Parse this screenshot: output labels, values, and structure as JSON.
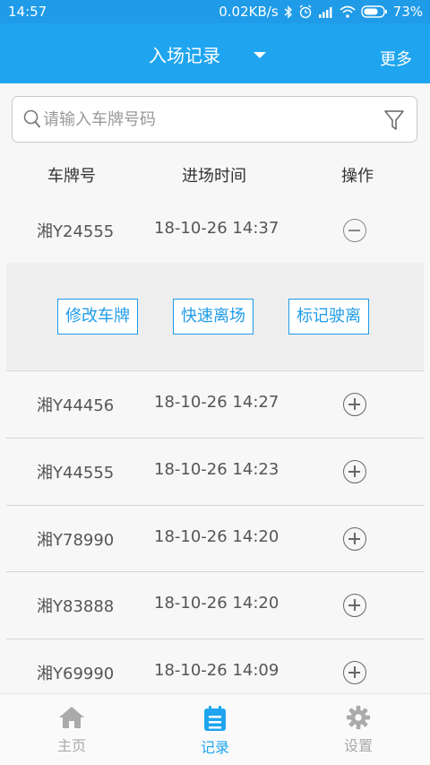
{
  "status_bar": {
    "time": "14:57",
    "speed": "0.02KB/s",
    "battery": "73%"
  },
  "header": {
    "title": "入场记录",
    "more": "更多"
  },
  "search": {
    "placeholder": "请输入车牌号码"
  },
  "columns": [
    "车牌号",
    "进场时间",
    "操作"
  ],
  "rows": [
    {
      "plate": "湘Y24555",
      "time": "18-10-26 14:37",
      "expanded": true
    },
    {
      "plate": "湘Y44456",
      "time": "18-10-26 14:27",
      "expanded": false
    },
    {
      "plate": "湘Y44555",
      "time": "18-10-26 14:23",
      "expanded": false
    },
    {
      "plate": "湘Y78990",
      "time": "18-10-26 14:20",
      "expanded": false
    },
    {
      "plate": "湘Y83888",
      "time": "18-10-26 14:20",
      "expanded": false
    },
    {
      "plate": "湘Y69990",
      "time": "18-10-26 14:09",
      "expanded": false
    }
  ],
  "row_actions": [
    "修改车牌",
    "快速离场",
    "标记驶离"
  ],
  "tabs": [
    {
      "label": "主页",
      "icon": "home-icon",
      "active": false
    },
    {
      "label": "记录",
      "icon": "record-icon",
      "active": true
    },
    {
      "label": "设置",
      "icon": "gear-icon",
      "active": false
    }
  ],
  "colors": {
    "primary": "#1fa5ef",
    "status_bar": "#1f9be8"
  }
}
